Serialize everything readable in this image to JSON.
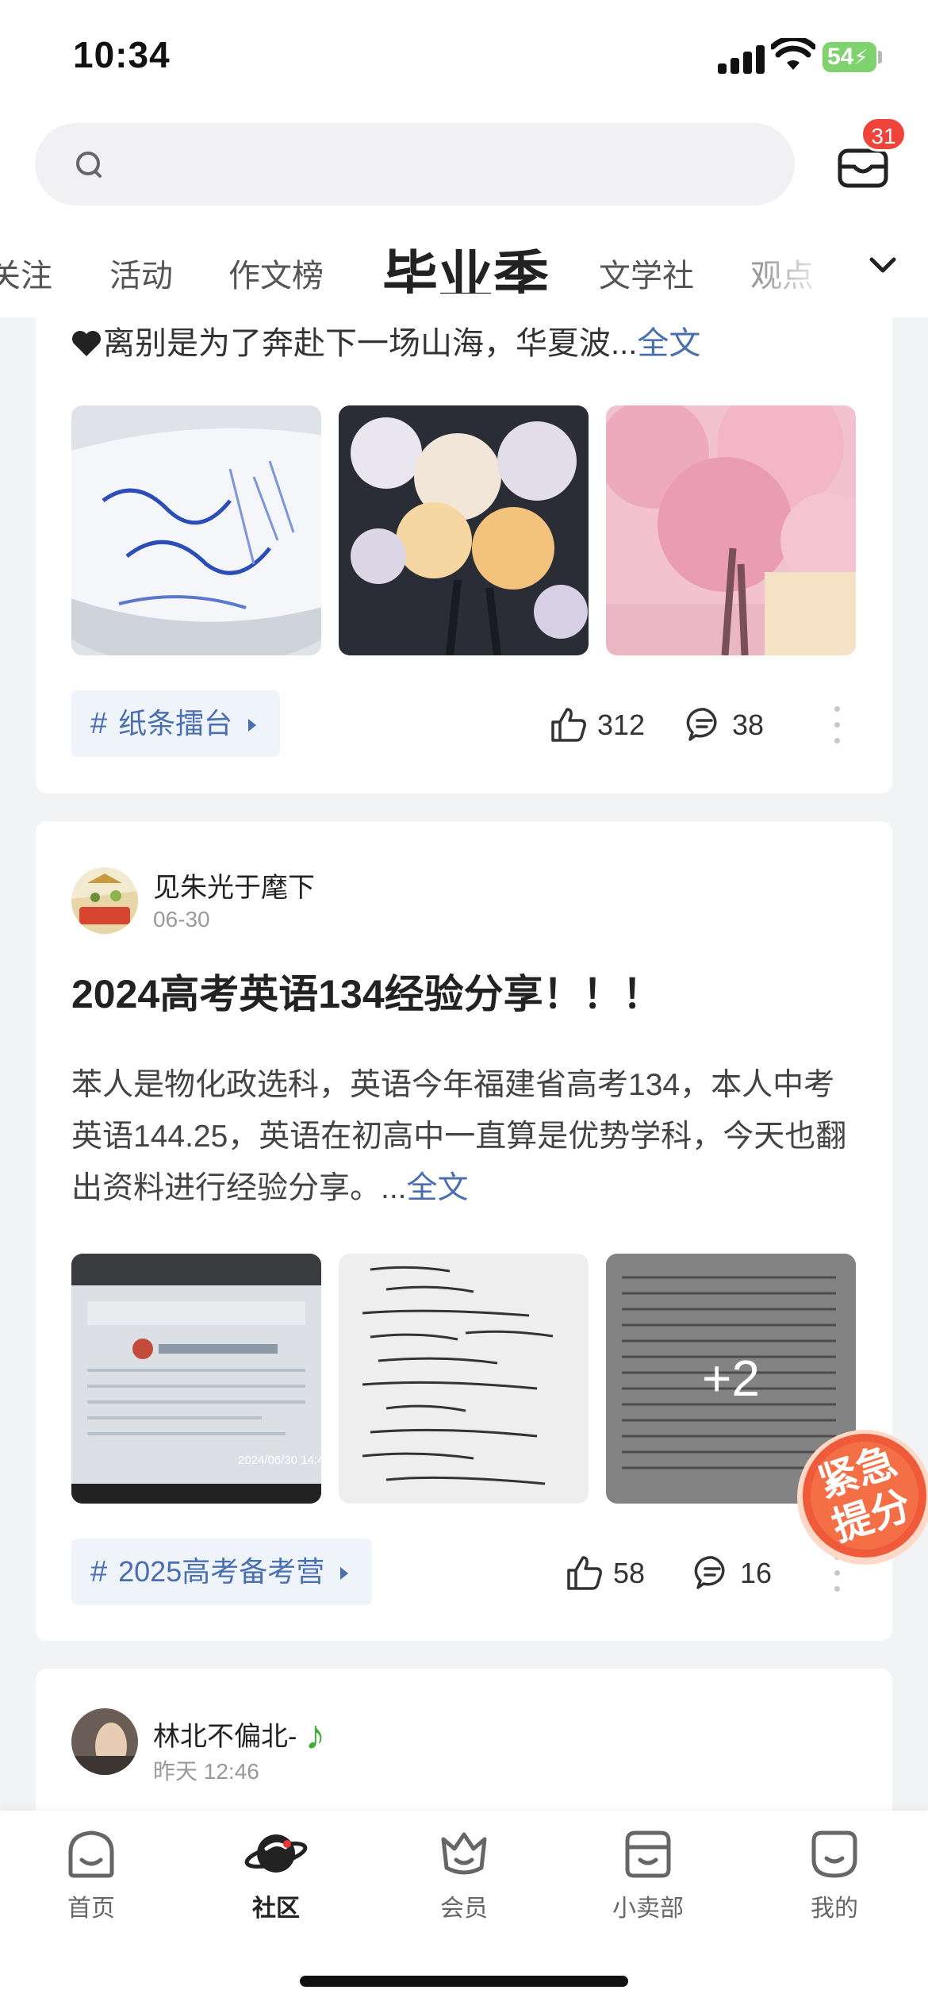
{
  "status_bar": {
    "time": "10:34",
    "battery": "54"
  },
  "header": {
    "inbox_badge": "31"
  },
  "tabs": [
    "关注",
    "活动",
    "作文榜",
    "毕业季",
    "文学社",
    "观点"
  ],
  "active_tab": "毕业季",
  "post1": {
    "snippet": "离别是为了奔赴下一场山海，华夏波...",
    "more_label": "全文",
    "topic": "纸条擂台",
    "likes": "312",
    "comments": "38"
  },
  "post2": {
    "author": "见朱光于麾下",
    "date": "06-30",
    "title": "2024高考英语134经验分享！！！",
    "body": "苯人是物化政选科，英语今年福建省高考134，本人中考英语144.25，英语在初高中一直算是优势学科，今天也翻出资料进行经验分享。...",
    "more_label": "全文",
    "extra_images": "+2",
    "screen_date": "2024/06/30 14:4",
    "topic": "2025高考备考营",
    "likes": "58",
    "comments": "16"
  },
  "post3": {
    "author": "林北不偏北-",
    "date": "昨天 12:46"
  },
  "promo": {
    "line1": "紧急",
    "line2": "提分"
  },
  "tabbar": [
    "首页",
    "社区",
    "会员",
    "小卖部",
    "我的"
  ],
  "tabbar_active": "社区",
  "colors": {
    "link": "#4a6fb1",
    "badge": "#f0433a",
    "battery": "#7ed36f",
    "promo": "#ef5b3a"
  }
}
